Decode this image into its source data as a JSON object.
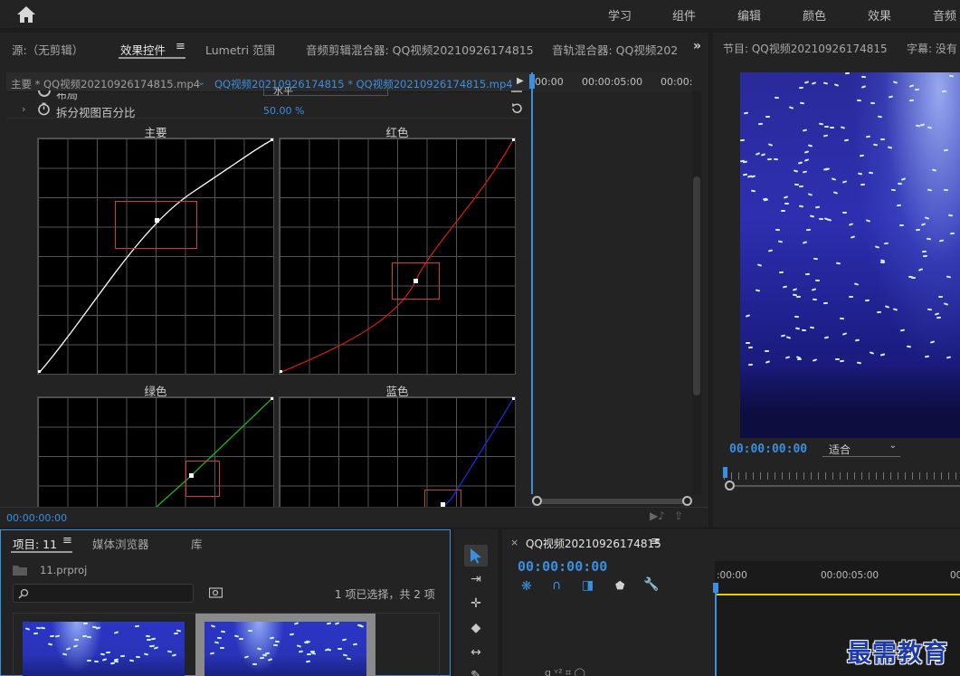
{
  "workspaces": [
    "学习",
    "组件",
    "编辑",
    "颜色",
    "效果",
    "音频"
  ],
  "left_tabs": [
    "源:（无剪辑）",
    "效果控件",
    "Lumetri 范围",
    "音频剪辑混合器: QQ视频20210926174815",
    "音轨混合器: QQ视频202"
  ],
  "effect_controls": {
    "master_tab": "主要 * QQ视频20210926174815.mp4",
    "clip_tab": "QQ视频20210926174815 * QQ视频20210926174815.mp4",
    "timeline_ticks": [
      "00:00",
      "00:00:05:00",
      "00:00:"
    ],
    "prop_cut": "布局",
    "prop_cut_value": "水平",
    "prop_label": "拆分视图百分比",
    "prop_value": "50.00 %",
    "timecode": "00:00:00:00"
  },
  "curves": {
    "master_label": "主要",
    "red_label": "红色",
    "green_label": "绿色",
    "blue_label": "蓝色",
    "colors": {
      "master": "#ffffff",
      "red": "#d01818",
      "green": "#14b814",
      "blue": "#1a2ad8"
    }
  },
  "program": {
    "tab1": "节目: QQ视频20210926174815",
    "tab2": "字幕: 没有",
    "timecode": "00:00:00:00",
    "fit": "适合"
  },
  "project": {
    "tabs": [
      "项目: 11",
      "媒体浏览器",
      "库"
    ],
    "file": "11.prproj",
    "selection": "1 项已选择，共 2 项"
  },
  "timeline": {
    "title": "QQ视频20210926174815",
    "timecode": "00:00:00:00",
    "ticks": [
      ":00:00",
      "00:00:05:00",
      "00"
    ]
  },
  "watermark": "最需教育"
}
